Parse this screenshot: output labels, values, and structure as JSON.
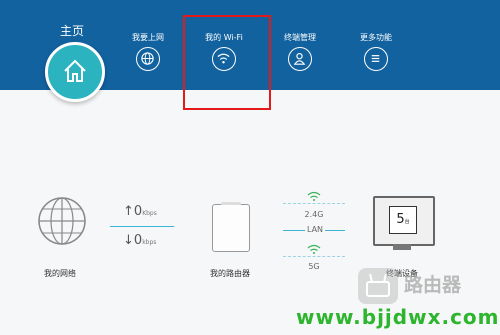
{
  "nav": {
    "home": {
      "label": "主页",
      "icon": "home-icon"
    },
    "items": [
      {
        "label": "我要上网",
        "icon": "globe-icon"
      },
      {
        "label": "我的 Wi-Fi",
        "icon": "wifi-icon"
      },
      {
        "label": "终端管理",
        "icon": "user-icon"
      },
      {
        "label": "更多功能",
        "icon": "menu-icon"
      }
    ]
  },
  "status": {
    "network_label": "我的网络",
    "upload_value": "0",
    "upload_unit": "Kbps",
    "download_value": "0",
    "download_unit": "kbps",
    "router_label": "我的路由器",
    "band_24": "2.4G",
    "band_lan": "LAN",
    "band_5": "5G",
    "devices_count": "5",
    "devices_unit": "台",
    "devices_label": "终端设备"
  },
  "watermark": {
    "site_name": "路由器",
    "url": "www.bjjdwx.com"
  },
  "colors": {
    "header": "#1262a0",
    "accent": "#2bb3c0",
    "highlight": "#e21a1a",
    "url": "#2eb52e"
  }
}
